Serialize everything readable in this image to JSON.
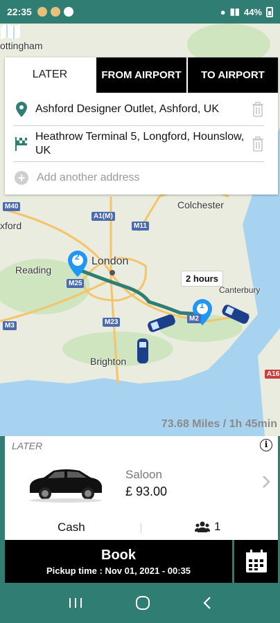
{
  "status_bar": {
    "time": "22:35",
    "battery": "44%"
  },
  "map": {
    "labels": [
      "ottingham",
      "xford",
      "Colchester",
      "Reading",
      "London",
      "Canterbury",
      "Brighton"
    ],
    "roads": [
      "M40",
      "A1(M)",
      "M11",
      "M25",
      "M23",
      "M3",
      "M2",
      "A16"
    ],
    "eta": "2 hours",
    "distance_summary": "73.68 Miles / 1h 45min",
    "pin_start": "1",
    "pin_end": "2"
  },
  "tabs": [
    {
      "label": "LATER"
    },
    {
      "label": "FROM AIRPORT"
    },
    {
      "label": "TO AIRPORT"
    }
  ],
  "addresses": {
    "pickup": "Ashford Designer Outlet, Ashford, UK",
    "dropoff": "Heathrow Terminal 5, Longford, Hounslow, UK",
    "add_placeholder": "Add another address"
  },
  "quote": {
    "mode": "LATER",
    "vehicle": "Saloon",
    "price": "£ 93.00",
    "payment": "Cash",
    "passengers": "1"
  },
  "book": {
    "label": "Book",
    "pickup_time": "Pickup time : Nov 01, 2021 - 00:35"
  },
  "colors": {
    "accent": "#2f7d73",
    "route": "#2f7d73",
    "pin": "#2196f3"
  }
}
